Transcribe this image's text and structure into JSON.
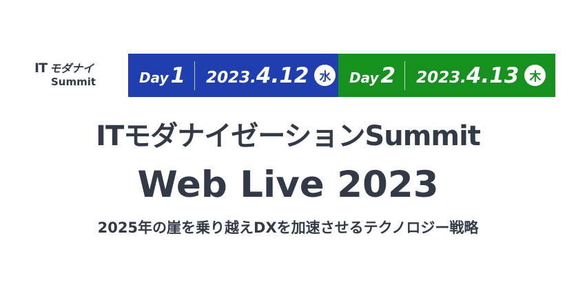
{
  "logo": {
    "it": "IT",
    "jp": "モダナイ",
    "en": "Summit"
  },
  "days": [
    {
      "label": "Day",
      "number": "1",
      "date_prefix": "2023.",
      "date_main": "4.12",
      "weekday": "水",
      "bg_color": "#1f3fb0",
      "weekday_color": "#1f3fb0"
    },
    {
      "label": "Day",
      "number": "2",
      "date_prefix": "2023.",
      "date_main": "4.13",
      "weekday": "木",
      "bg_color": "#16901e",
      "weekday_color": "#16901e"
    }
  ],
  "title_line1": "ITモダナイゼーションSummit",
  "title_line2": "Web Live 2023",
  "subtitle": "2025年の崖を乗り越えDXを加速させるテクノロジー戦略",
  "colors": {
    "text": "#333a47"
  }
}
